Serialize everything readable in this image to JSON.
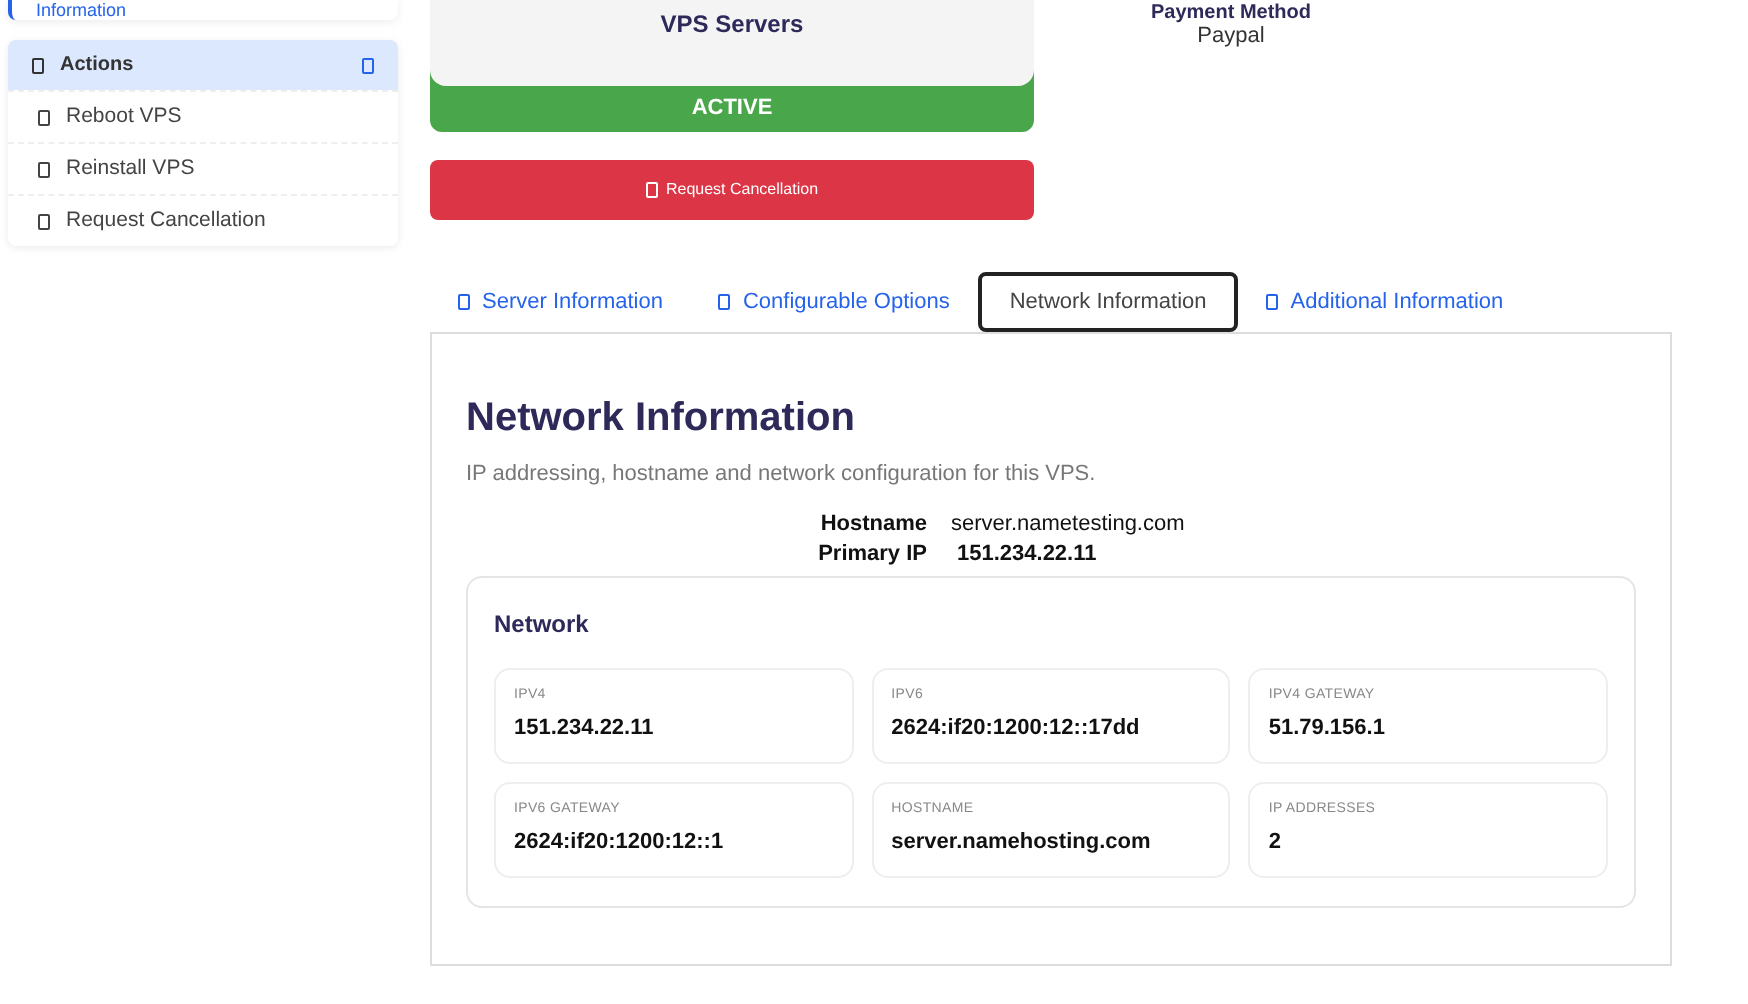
{
  "sidebar": {
    "top_item": "Information",
    "actions": {
      "title": "Actions",
      "expanded": true,
      "items": [
        "Reboot VPS",
        "Reinstall VPS",
        "Request Cancellation"
      ]
    }
  },
  "product": {
    "name": "VPS Servers",
    "status": "ACTIVE"
  },
  "cancel_button": "Request Cancellation",
  "payment": {
    "label": "Payment Method",
    "value": "Paypal"
  },
  "tabs": [
    {
      "label": "Server Information",
      "selected": false
    },
    {
      "label": "Configurable Options",
      "selected": false
    },
    {
      "label": "Network Information",
      "selected": true
    },
    {
      "label": "Additional Information",
      "selected": false
    }
  ],
  "panel": {
    "title": "Network Information",
    "description": "IP addressing, hostname and network configuration for this VPS.",
    "summary": [
      {
        "label": "Hostname",
        "value": "server.nametesting.com"
      },
      {
        "label": "Primary IP",
        "value": "151.234.22.11"
      }
    ],
    "network": {
      "title": "Network",
      "fields": [
        {
          "label": "IPV4",
          "value": "151.234.22.11"
        },
        {
          "label": "IPV6",
          "value": "2624:if20:1200:12::17dd"
        },
        {
          "label": "IPV4 GATEWAY",
          "value": "51.79.156.1"
        },
        {
          "label": "IPV6 GATEWAY",
          "value": "2624:if20:1200:12::1"
        },
        {
          "label": "HOSTNAME",
          "value": "server.namehosting.com"
        },
        {
          "label": "IP ADDRESSES",
          "value": "2"
        }
      ]
    }
  }
}
